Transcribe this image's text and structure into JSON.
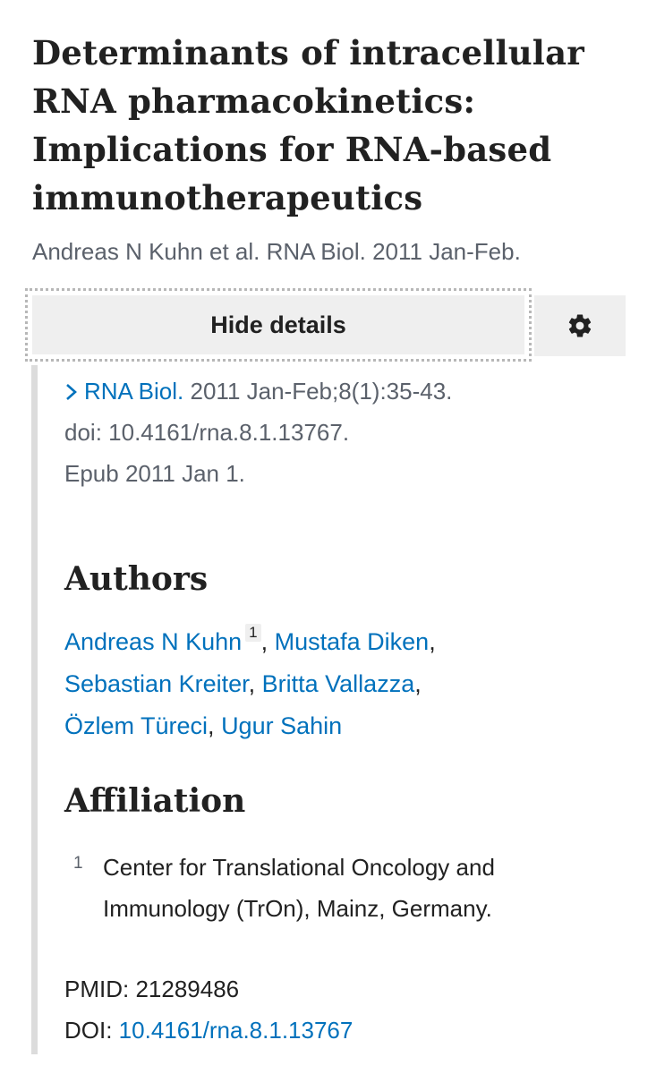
{
  "article": {
    "title_lines": [
      "Determinants of intracellular",
      "RNA pharmacokinetics:",
      "Implications for RNA-based",
      "immunotherapeutics"
    ],
    "short_citation": "Andreas N Kuhn et al. RNA Biol. 2011 Jan-Feb."
  },
  "details": {
    "hide_label": "Hide details",
    "settings_icon": "gear-icon",
    "chevron_icon": "chevron-right-icon",
    "journal": "RNA Biol.",
    "citation_rest": " 2011 Jan-Feb;8(1):35-43.",
    "doi_line": "doi: 10.4161/rna.8.1.13767.",
    "epub_line": "Epub 2011 Jan 1."
  },
  "authors": {
    "heading": "Authors",
    "list": [
      {
        "name": "Andreas N Kuhn",
        "affil": "1"
      },
      {
        "name": "Mustafa Diken"
      },
      {
        "name": "Sebastian Kreiter"
      },
      {
        "name": "Britta Vallazza"
      },
      {
        "name": "Özlem Türeci"
      },
      {
        "name": "Ugur Sahin"
      }
    ]
  },
  "affiliation": {
    "heading": "Affiliation",
    "number": "1",
    "lines": [
      "Center for Translational Oncology and",
      "Immunology (TrOn), Mainz, Germany."
    ]
  },
  "identifiers": {
    "pmid_label": "PMID: ",
    "pmid": "21289486",
    "doi_label": "DOI: ",
    "doi": "10.4161/rna.8.1.13767"
  },
  "colors": {
    "link": "#0071bc",
    "muted": "#5b616b",
    "button_bg": "#efefef",
    "rule": "#dcdcdc"
  }
}
